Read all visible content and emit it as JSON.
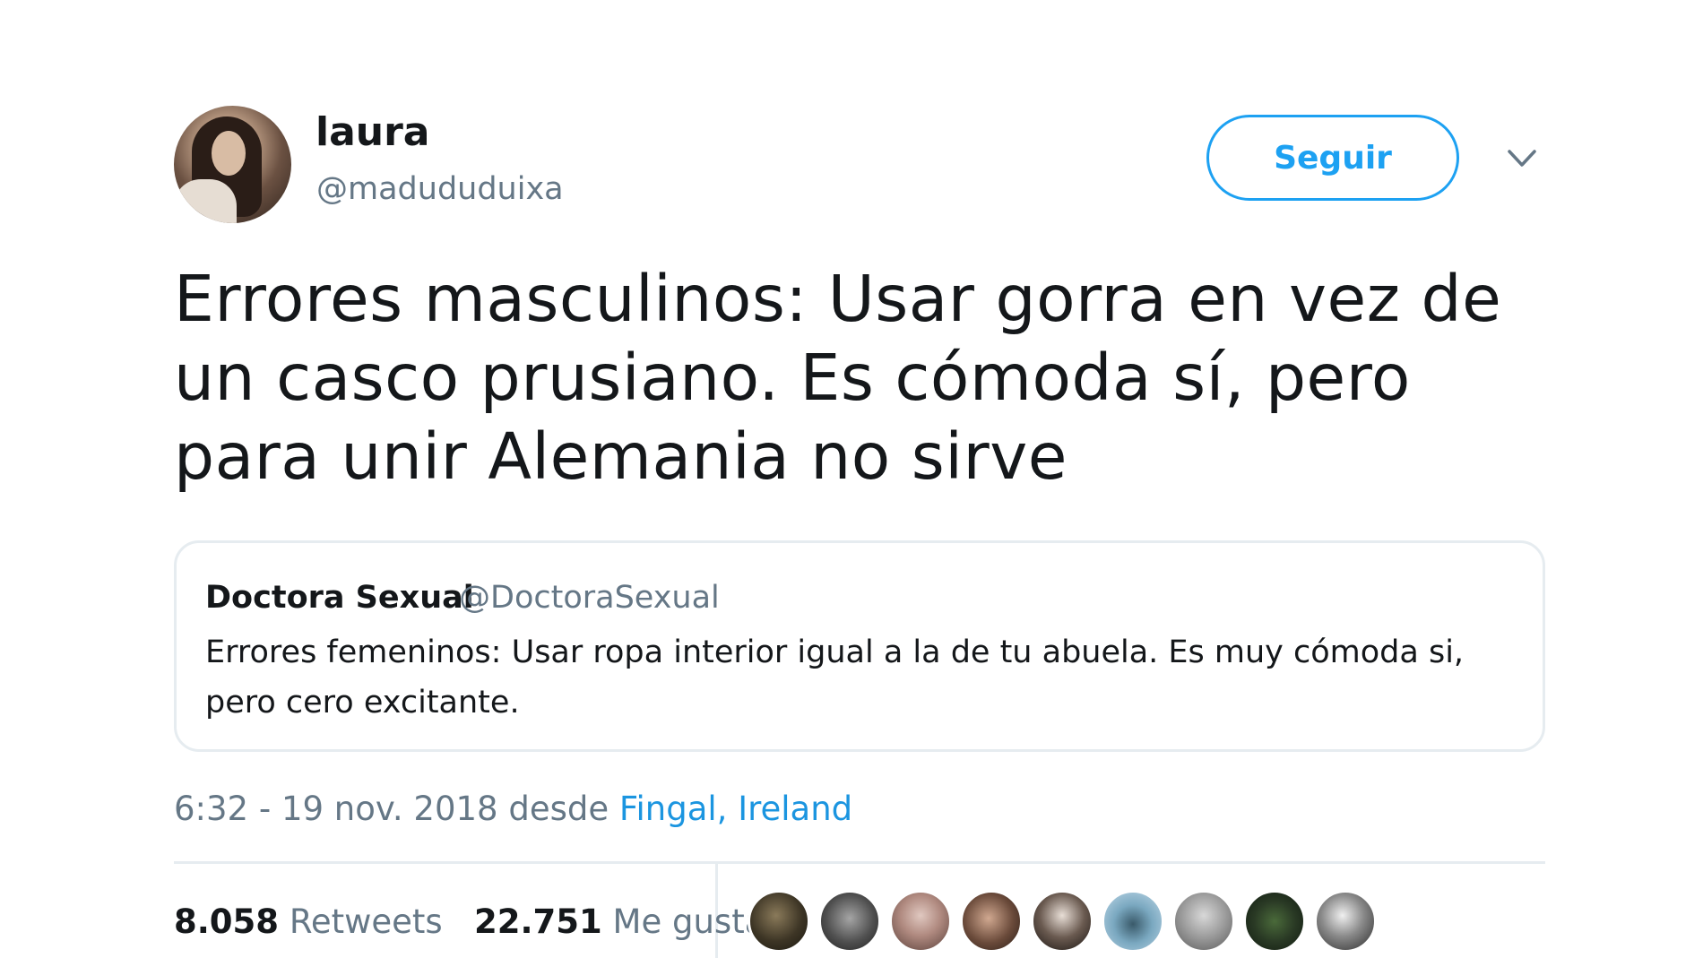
{
  "tweet": {
    "author_name": "laura",
    "author_handle": "@madududuixa",
    "follow_label": "Seguir",
    "text": "Errores masculinos: Usar gorra en vez de un casco prusiano. Es cómoda sí, pero para unir Alemania no sirve",
    "timestamp": "6:32 - 19 nov. 2018 desde ",
    "location": "Fingal, Ireland",
    "retweets_count": "8.058",
    "retweets_label": "Retweets",
    "likes_count": "22.751",
    "likes_label": "Me gusta"
  },
  "quoted": {
    "author_name": "Doctora Sexual",
    "author_handle": "@DoctoraSexual",
    "text": "Errores femeninos: Usar ropa interior igual a la de tu abuela. Es muy cómoda si, pero cero excitante."
  },
  "icons": {
    "more": "chevron-down-icon"
  },
  "colors": {
    "accent": "#1da1f2",
    "link": "#1b95e0",
    "muted": "#657786",
    "border": "#e6ecf0"
  }
}
